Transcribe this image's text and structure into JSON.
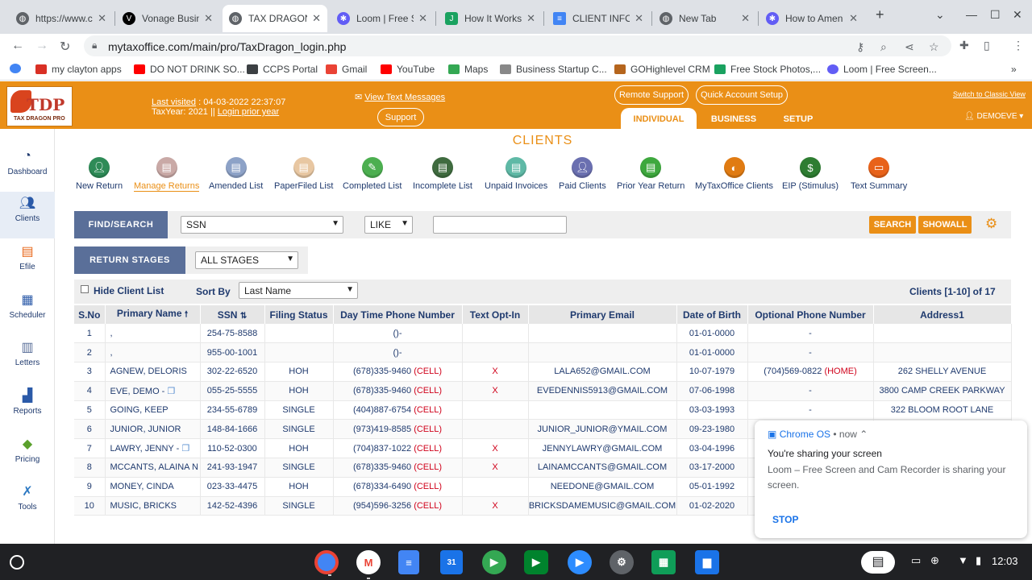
{
  "browser": {
    "tabs": [
      {
        "title": "https://www.c",
        "color": "#5f6368"
      },
      {
        "title": "Vonage Busin",
        "color": "#000000"
      },
      {
        "title": "TAX DRAGON",
        "color": "#5f6368"
      },
      {
        "title": "Loom | Free S",
        "color": "#625df5"
      },
      {
        "title": "How It Works",
        "color": "#1aa260"
      },
      {
        "title": "CLIENT INFO S",
        "color": "#4285f4"
      },
      {
        "title": "New Tab",
        "color": "#5f6368"
      },
      {
        "title": "How to Amen",
        "color": "#625df5"
      }
    ],
    "url": "mytaxoffice.com/main/pro/TaxDragon_login.php",
    "bookmarks": [
      "my clayton apps",
      "DO NOT DRINK SO...",
      "CCPS Portal",
      "Gmail",
      "YouTube",
      "Maps",
      "Business Startup C...",
      "GOHighlevel CRM",
      "Free Stock Photos,...",
      "Loom | Free Screen..."
    ]
  },
  "header": {
    "last_visited_label": "Last visited",
    "last_visited_value": ": 04-03-2022 22:37:07",
    "tax_year": "TaxYear:  2021  ||",
    "login_prior": "Login prior year",
    "view_text": "View Text Messages",
    "support": "Support",
    "remote_support": "Remote Support",
    "quick_setup": "Quick Account Setup",
    "classic_view": "Switch to Classic View",
    "user": "DEMOEVE",
    "tabs": [
      "INDIVIDUAL",
      "BUSINESS",
      "SETUP"
    ],
    "logo_text": "TDP",
    "logo_sub": "TAX DRAGON PRO"
  },
  "sidebar": [
    "Dashboard",
    "Clients",
    "Efile",
    "Scheduler",
    "Letters",
    "Reports",
    "Pricing",
    "Tools"
  ],
  "page_title": "CLIENTS",
  "quick_actions": [
    "New Return",
    "Manage Returns",
    "Amended List",
    "PaperFiled List",
    "Completed List",
    "Incomplete List",
    "Unpaid Invoices",
    "Paid Clients",
    "Prior Year Return",
    "MyTaxOffice Clients",
    "EIP (Stimulus)",
    "Text Summary"
  ],
  "find": {
    "label": "FIND/SEARCH",
    "field": "SSN",
    "op": "LIKE",
    "search": "SEARCH",
    "showall": "SHOWALL"
  },
  "stages": {
    "label": "RETURN STAGES",
    "value": "ALL STAGES"
  },
  "list": {
    "hide_label": "Hide Client List",
    "sort_label": "Sort By",
    "sort_value": "Last Name",
    "count": "Clients [1-10] of 17"
  },
  "table": {
    "headers": [
      "S.No",
      "Primary Name",
      "SSN",
      "Filing Status",
      "Day Time Phone Number",
      "Text Opt-In",
      "Primary Email",
      "Date of Birth",
      "Optional Phone Number",
      "Address1"
    ],
    "rows": [
      [
        "1",
        ",",
        "254-75-8588",
        "",
        "()-",
        "",
        "",
        "",
        "01-01-0000",
        "-",
        "",
        ""
      ],
      [
        "2",
        ",",
        "955-00-1001",
        "",
        "()-",
        "",
        "",
        "",
        "01-01-0000",
        "-",
        "",
        ""
      ],
      [
        "3",
        "AGNEW, DELORIS",
        "302-22-6520",
        "HOH",
        "(678)335-9460",
        "(CELL)",
        "X",
        "LALA652@GMAIL.COM",
        "10-07-1979",
        "(704)569-0822",
        "(HOME)",
        "262 SHELLY AVENUE"
      ],
      [
        "4",
        "EVE, DEMO -",
        "055-25-5555",
        "HOH",
        "(678)335-9460",
        "(CELL)",
        "X",
        "EVEDENNIS5913@GMAIL.COM",
        "07-06-1998",
        "-",
        "",
        "3800 CAMP CREEK PARKWAY"
      ],
      [
        "5",
        "GOING, KEEP",
        "234-55-6789",
        "SINGLE",
        "(404)887-6754",
        "(CELL)",
        "",
        "",
        "03-03-1993",
        "-",
        "",
        "322 BLOOM ROOT LANE"
      ],
      [
        "6",
        "JUNIOR, JUNIOR",
        "148-84-1666",
        "SINGLE",
        "(973)419-8585",
        "(CELL)",
        "",
        "JUNIOR_JUNIOR@YMAIL.COM",
        "09-23-1980",
        "",
        "",
        ""
      ],
      [
        "7",
        "LAWRY, JENNY -",
        "110-52-0300",
        "HOH",
        "(704)837-1022",
        "(CELL)",
        "X",
        "JENNYLAWRY@GMAIL.COM",
        "03-04-1996",
        "",
        "",
        ""
      ],
      [
        "8",
        "MCCANTS, ALAINA N",
        "241-93-1947",
        "SINGLE",
        "(678)335-9460",
        "(CELL)",
        "X",
        "LAINAMCCANTS@GMAIL.COM",
        "03-17-2000",
        "",
        "",
        ""
      ],
      [
        "9",
        "MONEY, CINDA",
        "023-33-4475",
        "HOH",
        "(678)334-6490",
        "(CELL)",
        "",
        "NEEDONE@GMAIL.COM",
        "05-01-1992",
        "",
        "",
        ""
      ],
      [
        "10",
        "MUSIC, BRICKS",
        "142-52-4396",
        "SINGLE",
        "(954)596-3256",
        "(CELL)",
        "X",
        "BRICKSDAMEMUSIC@GMAIL.COM",
        "01-02-2020",
        "",
        "",
        ""
      ]
    ]
  },
  "notification": {
    "source": "Chrome OS",
    "time": "• now ⌃",
    "title": "You're sharing your screen",
    "body": "Loom – Free Screen and Cam Recorder is sharing your screen.",
    "stop": "STOP"
  },
  "shelf": {
    "time": "12:03"
  }
}
